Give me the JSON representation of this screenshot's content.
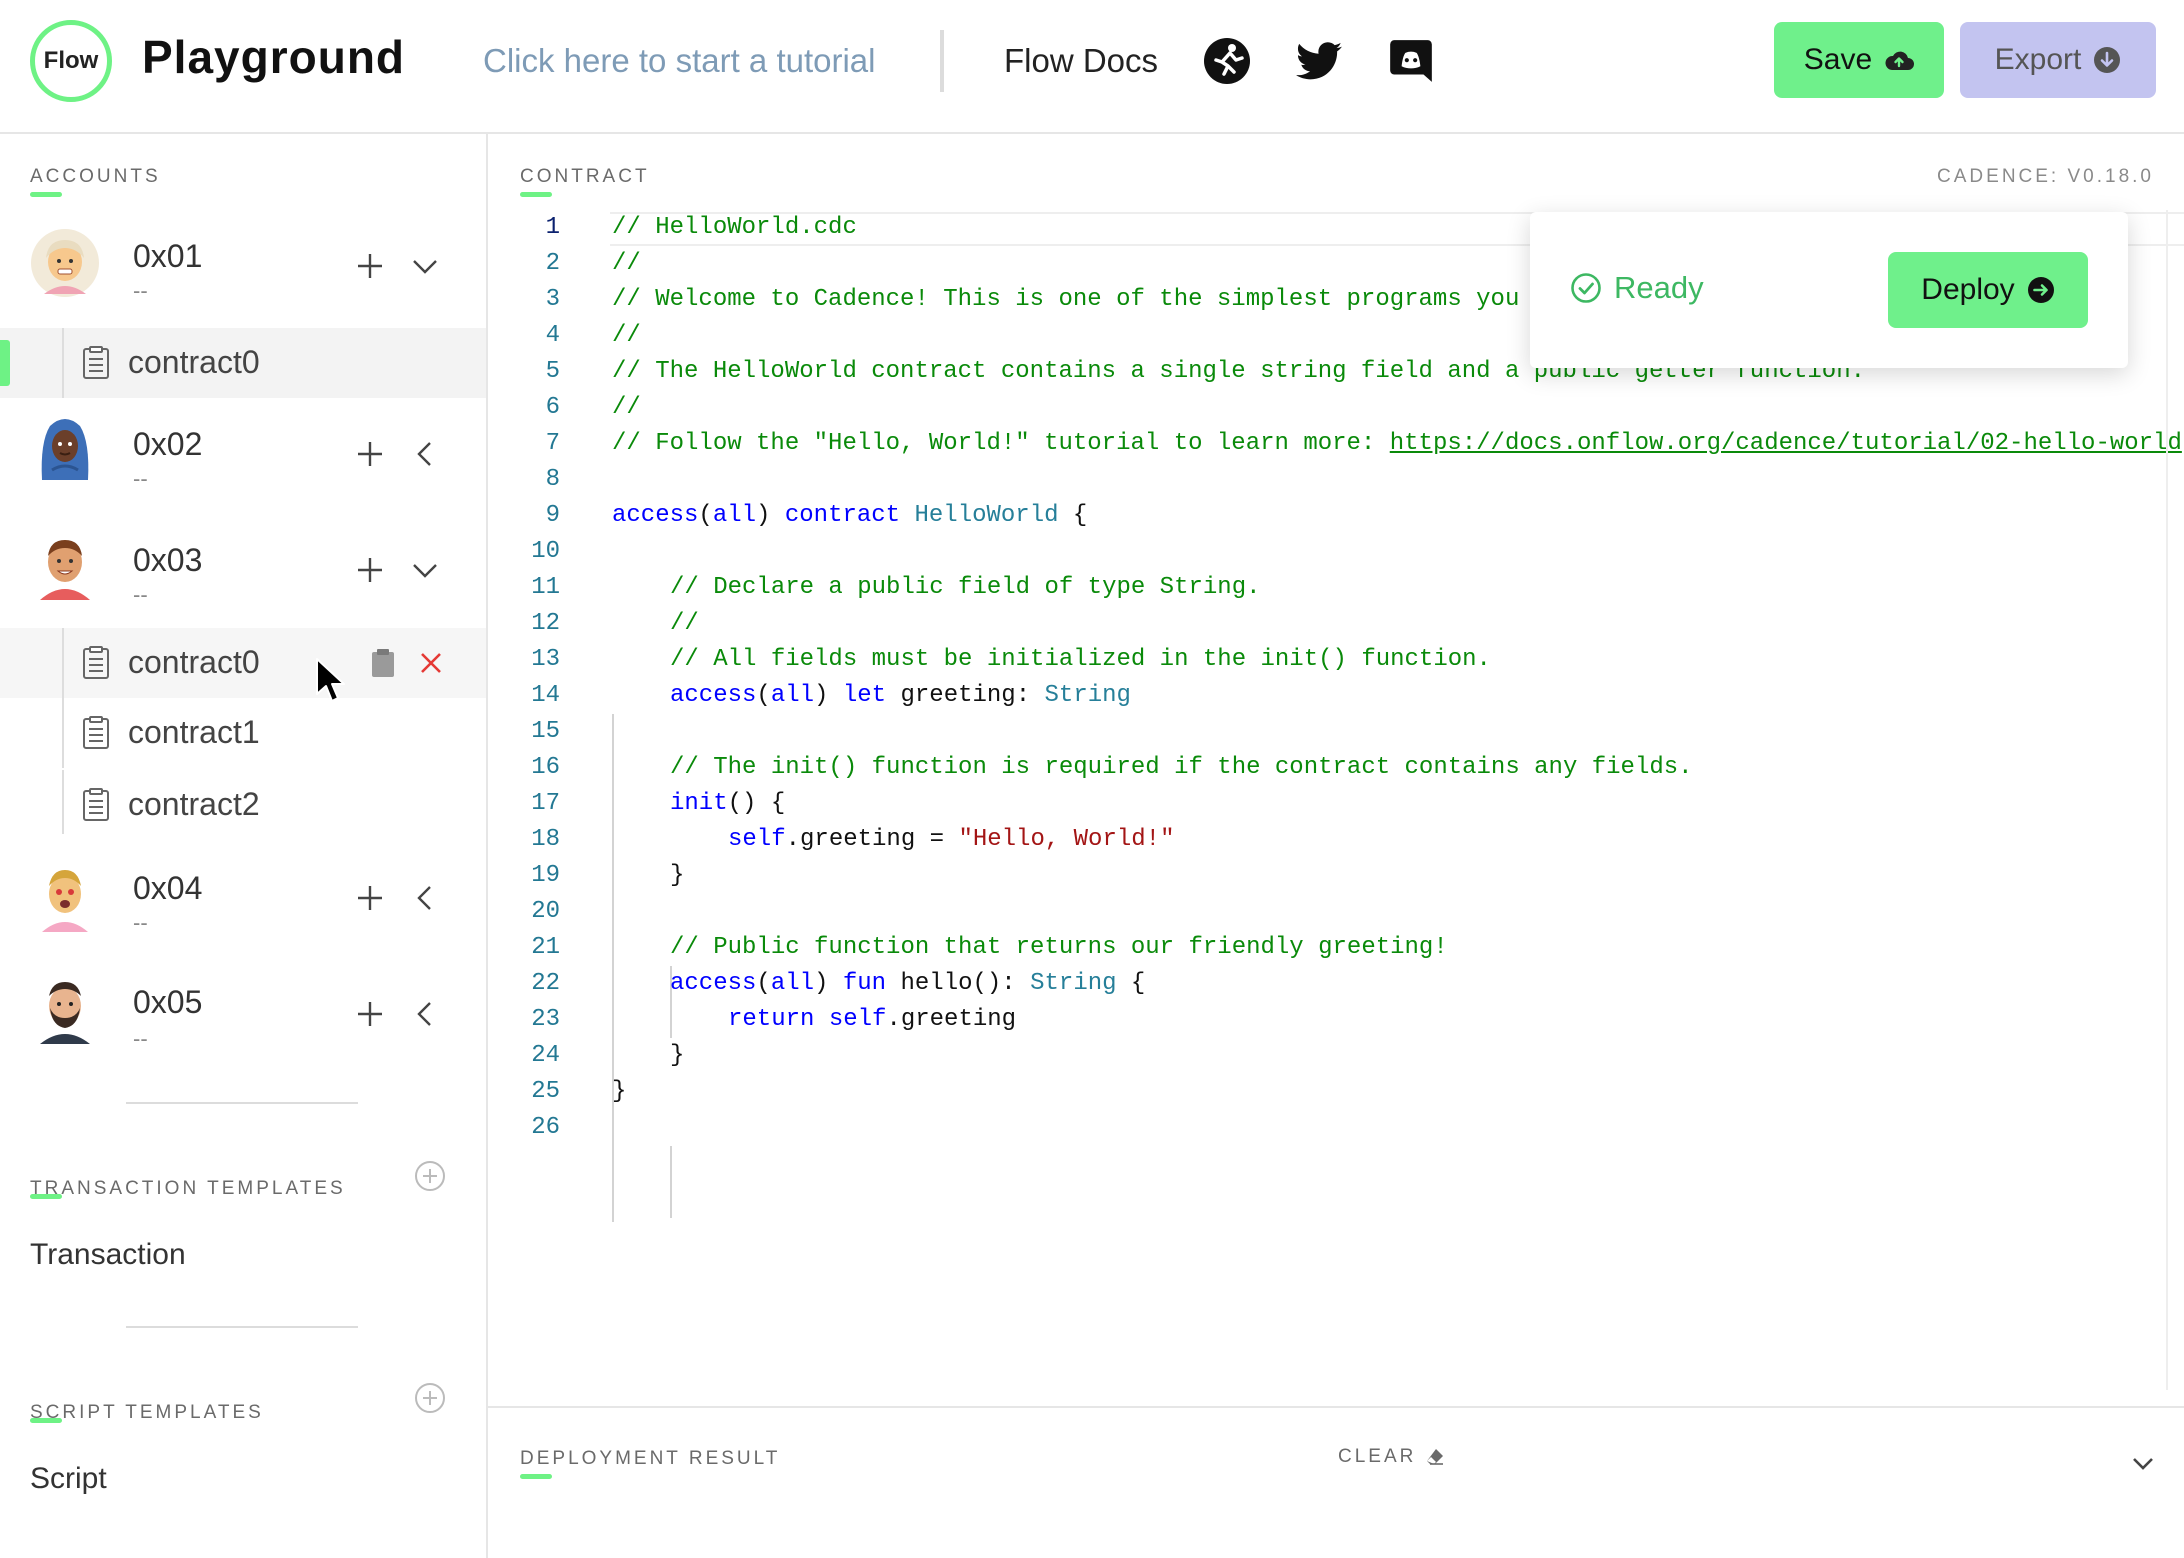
{
  "header": {
    "logo_text": "Flow",
    "title": "Playground",
    "tutorial_link": "Click here to start a tutorial",
    "docs_link": "Flow Docs",
    "social_icons": [
      "runner-icon",
      "twitter-icon",
      "discord-icon"
    ],
    "save_label": "Save",
    "export_label": "Export"
  },
  "sidebar": {
    "accounts_label": "ACCOUNTS",
    "accounts": [
      {
        "address": "0x01",
        "subtitle": "--",
        "expanded": true
      },
      {
        "address": "0x02",
        "subtitle": "--",
        "expanded": false
      },
      {
        "address": "0x03",
        "subtitle": "--",
        "expanded": true
      },
      {
        "address": "0x04",
        "subtitle": "--",
        "expanded": false
      },
      {
        "address": "0x05",
        "subtitle": "--",
        "expanded": false
      }
    ],
    "account1_contracts": [
      "contract0"
    ],
    "account3_contracts": [
      "contract0",
      "contract1",
      "contract2"
    ],
    "transaction_templates_label": "TRANSACTION TEMPLATES",
    "transaction_item": "Transaction",
    "script_templates_label": "SCRIPT TEMPLATES",
    "script_item": "Script"
  },
  "editor": {
    "label": "CONTRACT",
    "cadence_version": "CADENCE: V0.18.0",
    "current_line": 1,
    "line_numbers": [
      "1",
      "2",
      "3",
      "4",
      "5",
      "6",
      "7",
      "8",
      "9",
      "10",
      "11",
      "12",
      "13",
      "14",
      "15",
      "16",
      "17",
      "18",
      "19",
      "20",
      "21",
      "22",
      "23",
      "24",
      "25",
      "26"
    ],
    "code": {
      "l1": "// HelloWorld.cdc",
      "l2": "//",
      "l3": "// Welcome to Cadence! This is one of the simplest programs you",
      "l4": "//",
      "l5": "// The HelloWorld contract contains a single string field and a public getter function.",
      "l6": "//",
      "l7_text": "// Follow the \"Hello, World!\" tutorial to learn more: ",
      "l7_url": "https://docs.onflow.org/cadence/tutorial/02-hello-world",
      "l9_access": "access",
      "l9_all": "all",
      "l9_contract": "contract",
      "l9_name": "HelloWorld",
      "l11": "// Declare a public field of type String.",
      "l12": "//",
      "l13": "// All fields must be initialized in the init() function.",
      "l14_let": "let",
      "l14_name": "greeting: ",
      "l14_type": "String",
      "l16": "// The init() function is required if the contract contains any fields.",
      "l17_init": "init",
      "l18_self": "self",
      "l18_rest": ".greeting = ",
      "l18_str": "\"Hello, World!\"",
      "l21": "// Public function that returns our friendly greeting!",
      "l22_fun": "fun",
      "l22_name": " hello(): ",
      "l22_type": "String",
      "l23_return": "return",
      "l23_self": "self",
      "l23_rest": ".greeting"
    }
  },
  "deploy": {
    "status": "Ready",
    "button_label": "Deploy"
  },
  "result": {
    "label": "DEPLOYMENT RESULT",
    "clear_label": "CLEAR"
  },
  "colors": {
    "accent": "#6ef285",
    "save_button": "#6ff08b",
    "export_button": "#c3c4f0",
    "comment": "#0a8a0a",
    "keyword": "#0000ff",
    "type": "#267f99",
    "string": "#a31515",
    "delete": "#e53935"
  }
}
